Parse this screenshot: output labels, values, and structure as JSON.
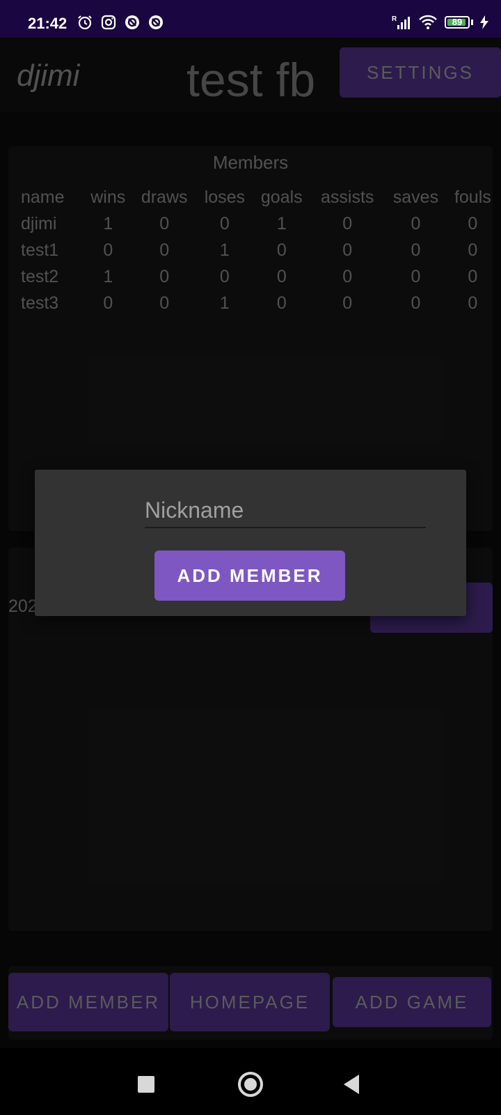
{
  "status_bar": {
    "time": "21:42",
    "battery_level": "89",
    "icons": [
      "alarm-icon",
      "instagram-icon",
      "app-icon",
      "app-icon",
      "signal-icon",
      "wifi-icon",
      "battery-icon",
      "charging-icon"
    ]
  },
  "header": {
    "user": "djimi",
    "title": "test fb",
    "settings_label": "SETTINGS"
  },
  "members": {
    "title": "Members",
    "columns": [
      "name",
      "wins",
      "draws",
      "loses",
      "goals",
      "assists",
      "saves",
      "fouls"
    ],
    "rows": [
      [
        "djimi",
        "1",
        "0",
        "0",
        "1",
        "0",
        "0",
        "0"
      ],
      [
        "test1",
        "0",
        "0",
        "1",
        "0",
        "0",
        "0",
        "0"
      ],
      [
        "test2",
        "1",
        "0",
        "0",
        "0",
        "0",
        "0",
        "0"
      ],
      [
        "test3",
        "0",
        "0",
        "1",
        "0",
        "0",
        "0",
        "0"
      ]
    ]
  },
  "games": {
    "partial_date": "202"
  },
  "bottom_bar": {
    "add_member": "ADD MEMBER",
    "homepage": "HOMEPAGE",
    "add_game": "ADD GAME"
  },
  "dialog": {
    "nickname_placeholder": "Nickname",
    "nickname_value": "",
    "add_member_label": "ADD MEMBER"
  },
  "colors": {
    "accent": "#7e57c2",
    "accent_dim": "#3b2466",
    "status_bar": "#1a0640"
  }
}
